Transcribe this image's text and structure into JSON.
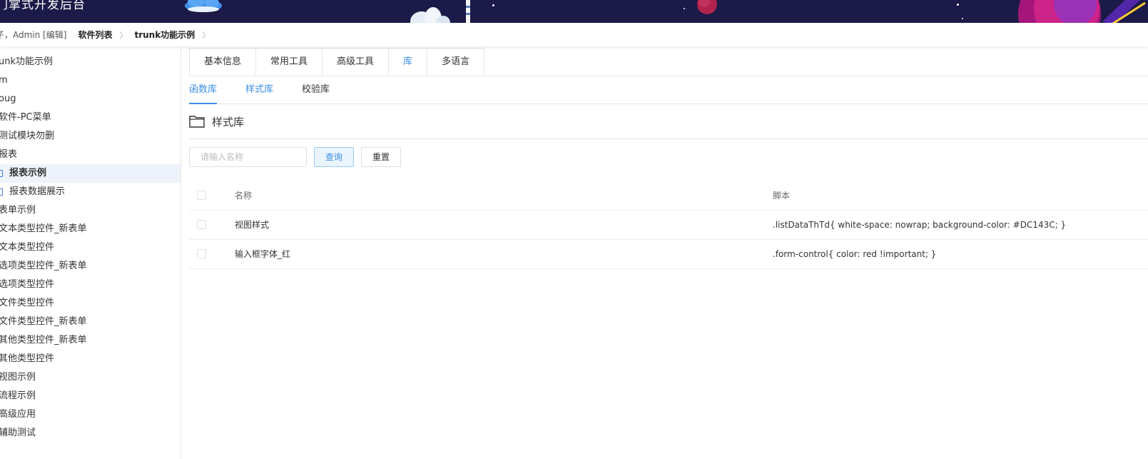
{
  "header": {
    "title": "门掌式开发后台"
  },
  "breadcrumb": {
    "user": "子，Admin [编辑]",
    "items": [
      "软件列表",
      "trunk功能示例"
    ]
  },
  "sidebar": {
    "items": [
      "unk功能示例",
      "m",
      "oug",
      "软件-PC菜单",
      "测试模块勿删",
      "报表",
      "报表示例",
      "报表数据展示",
      "表单示例",
      "文本类型控件_新表单",
      "文本类型控件",
      "选项类型控件_新表单",
      "选项类型控件",
      "文件类型控件",
      "文件类型控件_新表单",
      "其他类型控件_新表单",
      "其他类型控件",
      "视图示例",
      "流程示例",
      "高级应用",
      "辅助测试"
    ]
  },
  "tabs": [
    "基本信息",
    "常用工具",
    "高级工具",
    "库",
    "多语言"
  ],
  "subtabs": [
    "函数库",
    "样式库",
    "校验库"
  ],
  "section": {
    "title": "样式库"
  },
  "search": {
    "placeholder": "请输入名称",
    "query_label": "查询",
    "reset_label": "重置"
  },
  "table": {
    "columns": [
      "名称",
      "脚本"
    ],
    "rows": [
      {
        "name": "视图样式",
        "script": ".listDataThTd{ white-space: nowrap; background-color: #DC143C; }"
      },
      {
        "name": "输入框字体_红",
        "script": ".form-control{ color: red !important; }"
      }
    ]
  },
  "colors": {
    "header_bg": "#1c1a48",
    "accent": "#3a8ee6",
    "active_row_bg": "#eef3fb"
  }
}
